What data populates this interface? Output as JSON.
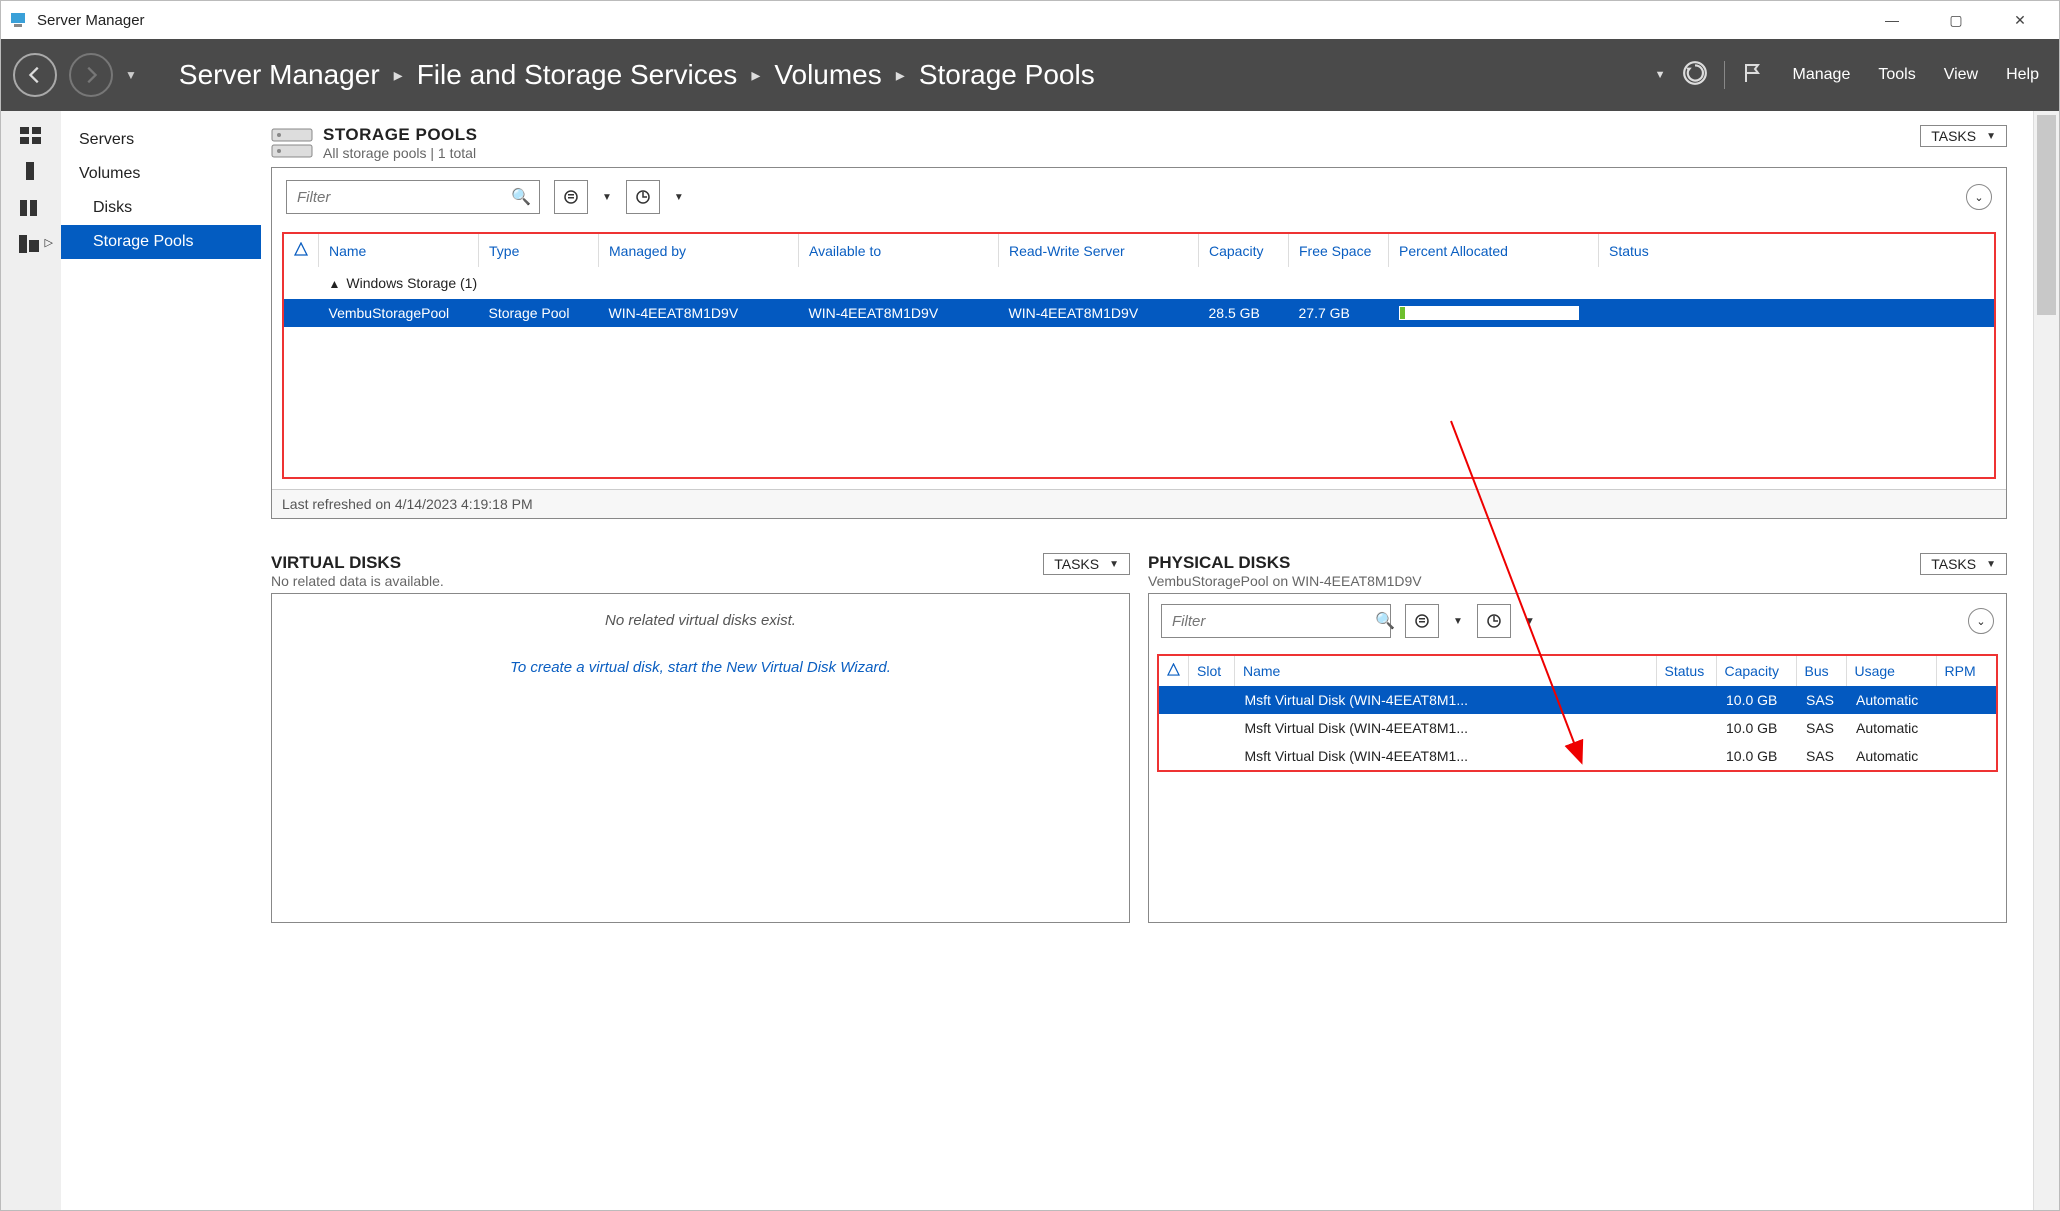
{
  "app": {
    "title": "Server Manager"
  },
  "window_controls": {
    "minimize": "—",
    "maximize": "▢",
    "close": "✕"
  },
  "topbar": {
    "breadcrumb": [
      "Server Manager",
      "File and Storage Services",
      "Volumes",
      "Storage Pools"
    ],
    "menu": {
      "manage": "Manage",
      "tools": "Tools",
      "view": "View",
      "help": "Help"
    }
  },
  "sidebar": {
    "items": [
      {
        "label": "Servers",
        "indent": false,
        "selected": false
      },
      {
        "label": "Volumes",
        "indent": false,
        "selected": false
      },
      {
        "label": "Disks",
        "indent": true,
        "selected": false
      },
      {
        "label": "Storage Pools",
        "indent": true,
        "selected": true
      }
    ]
  },
  "storage_pools": {
    "title": "STORAGE POOLS",
    "subtitle": "All storage pools | 1 total",
    "tasks_label": "TASKS",
    "filter_placeholder": "Filter",
    "columns": [
      "Name",
      "Type",
      "Managed by",
      "Available to",
      "Read-Write Server",
      "Capacity",
      "Free Space",
      "Percent Allocated",
      "Status"
    ],
    "group_label": "Windows Storage (1)",
    "row": {
      "name": "VembuStoragePool",
      "type": "Storage Pool",
      "managed_by": "WIN-4EEAT8M1D9V",
      "available_to": "WIN-4EEAT8M1D9V",
      "rw_server": "WIN-4EEAT8M1D9V",
      "capacity": "28.5 GB",
      "free_space": "27.7 GB",
      "percent_allocated": 3
    },
    "footer": "Last refreshed on 4/14/2023 4:19:18 PM"
  },
  "virtual_disks": {
    "title": "VIRTUAL DISKS",
    "subtitle": "No related data is available.",
    "tasks_label": "TASKS",
    "msg1": "No related virtual disks exist.",
    "msg2": "To create a virtual disk, start the New Virtual Disk Wizard."
  },
  "physical_disks": {
    "title": "PHYSICAL DISKS",
    "subtitle": "VembuStoragePool on WIN-4EEAT8M1D9V",
    "tasks_label": "TASKS",
    "filter_placeholder": "Filter",
    "columns": [
      "Slot",
      "Name",
      "Status",
      "Capacity",
      "Bus",
      "Usage",
      "RPM"
    ],
    "rows": [
      {
        "name": "Msft Virtual Disk (WIN-4EEAT8M1...",
        "capacity": "10.0 GB",
        "bus": "SAS",
        "usage": "Automatic",
        "selected": true
      },
      {
        "name": "Msft Virtual Disk (WIN-4EEAT8M1...",
        "capacity": "10.0 GB",
        "bus": "SAS",
        "usage": "Automatic",
        "selected": false
      },
      {
        "name": "Msft Virtual Disk (WIN-4EEAT8M1...",
        "capacity": "10.0 GB",
        "bus": "SAS",
        "usage": "Automatic",
        "selected": false
      }
    ]
  }
}
